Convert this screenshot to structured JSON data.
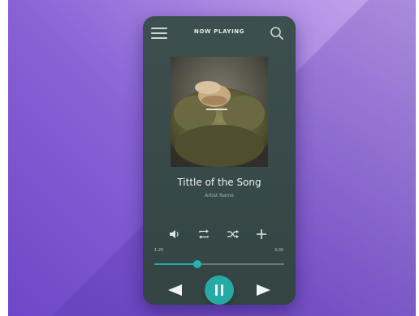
{
  "header": {
    "title": "NOW PLAYING",
    "menu_icon": "hamburger-icon",
    "search_icon": "search-icon"
  },
  "track": {
    "title": "Tittle of the Song",
    "artist": "Artist Name"
  },
  "playback": {
    "elapsed": "1:25",
    "total": "3:30",
    "progress_percent": 33
  },
  "controls": {
    "secondary": [
      "volume-icon",
      "repeat-icon",
      "shuffle-icon",
      "add-icon"
    ],
    "primary": [
      "previous-icon",
      "pause-icon",
      "next-icon"
    ]
  },
  "colors": {
    "accent": "#26aaa4",
    "panel": "#3a4c4b",
    "background_light": "#c9a9ee",
    "background_dark": "#6d47c8"
  }
}
